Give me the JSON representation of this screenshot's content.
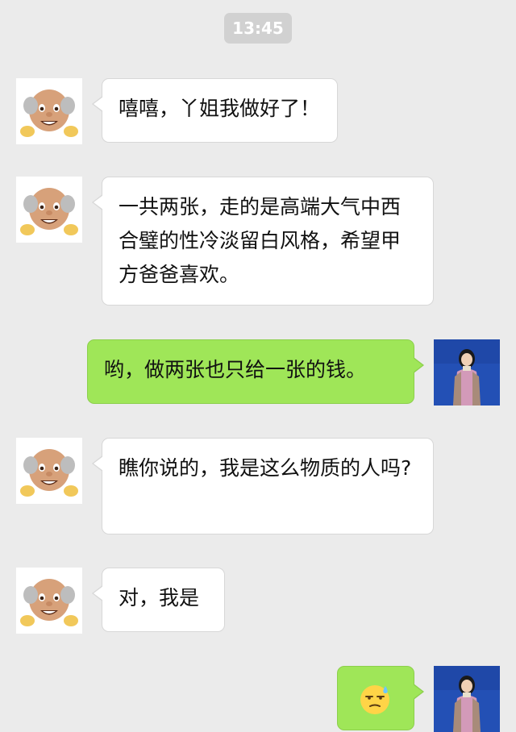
{
  "timestamp": "13:45",
  "colors": {
    "background": "#ebebeb",
    "incoming_bubble": "#ffffff",
    "outgoing_bubble": "#9fe658",
    "time_pill": "#d1d1d1"
  },
  "contacts": {
    "other": {
      "avatar_icon": "old-man-emoji-avatar"
    },
    "self": {
      "avatar_icon": "woman-photo-avatar"
    }
  },
  "messages": [
    {
      "sender": "other",
      "text": "嘻嘻，丫姐我做好了！"
    },
    {
      "sender": "other",
      "text": "一共两张，走的是高端大气中西合璧的性冷淡留白风格，希望甲方爸爸喜欢。"
    },
    {
      "sender": "self",
      "text": "哟，做两张也只给一张的钱。"
    },
    {
      "sender": "other",
      "text": "瞧你说的，我是这么物质的人吗?"
    },
    {
      "sender": "other",
      "text": "对，我是"
    },
    {
      "sender": "self",
      "emoji": "sweat-smile-emoji"
    }
  ]
}
